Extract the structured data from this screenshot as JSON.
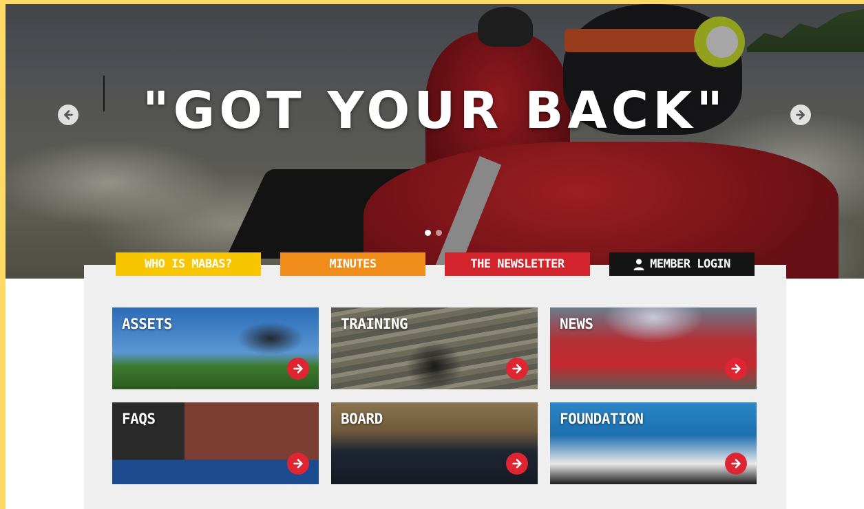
{
  "hero": {
    "quote": "\"GOT YOUR BACK\"",
    "slide_count": 2,
    "active_slide": 1,
    "prev_icon": "chevron-left-icon",
    "next_icon": "chevron-right-icon"
  },
  "tabs": [
    {
      "label": "WHO IS MABAS?",
      "color": "#f7c600"
    },
    {
      "label": "MINUTES",
      "color": "#f18d1b"
    },
    {
      "label": "THE NEWSLETTER",
      "color": "#d3232c"
    },
    {
      "label": "MEMBER LOGIN",
      "color": "#141414",
      "icon": "user-icon"
    }
  ],
  "cards": [
    {
      "label": "ASSETS"
    },
    {
      "label": "TRAINING"
    },
    {
      "label": "NEWS"
    },
    {
      "label": "FAQS"
    },
    {
      "label": "BOARD"
    },
    {
      "label": "FOUNDATION"
    }
  ],
  "colors": {
    "page_border": "#ffd966",
    "panel_bg": "#efefef",
    "card_button": "#e02532"
  }
}
